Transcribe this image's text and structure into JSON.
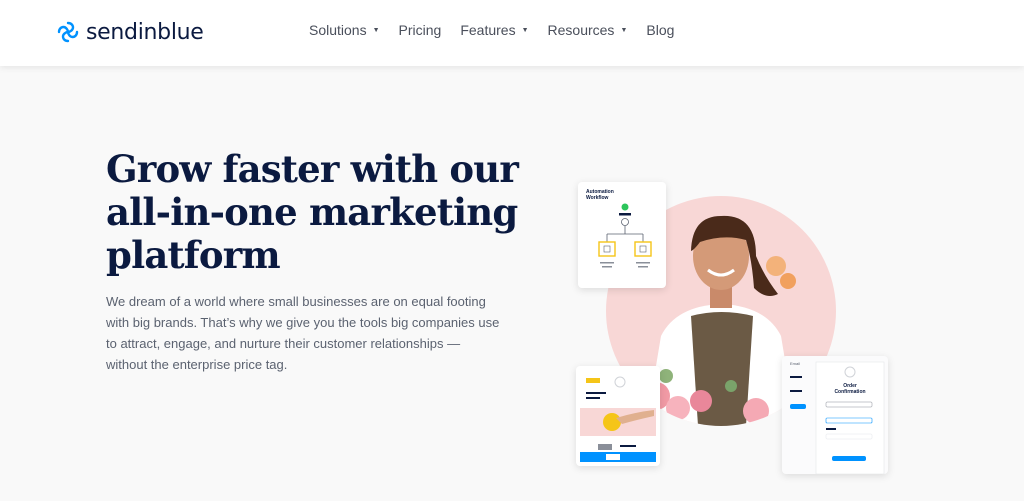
{
  "brand": {
    "name": "sendinblue",
    "color": "#0092ff"
  },
  "nav": [
    {
      "label": "Solutions",
      "caret": true
    },
    {
      "label": "Pricing",
      "caret": false
    },
    {
      "label": "Features",
      "caret": true
    },
    {
      "label": "Resources",
      "caret": true
    },
    {
      "label": "Blog",
      "caret": false
    }
  ],
  "hero": {
    "title_lines": [
      "Grow faster with our",
      "all-in-one marketing",
      "platform"
    ],
    "body_lines": [
      "We dream of a world where small businesses are on equal footing",
      "with big brands. That’s why we give you the tools big companies use",
      "to attract, engage, and nurture their customer relationships —",
      "without the enterprise price tag."
    ]
  },
  "illustration": {
    "workflow_card": {
      "title_1": "Automation",
      "title_2": "Workflow"
    },
    "order_card": {
      "title_1": "Order",
      "title_2": "Confirmation"
    },
    "email_panel": {
      "label": "Email"
    }
  },
  "colors": {
    "accent_blue": "#0092ff",
    "title_navy": "#0b1a40",
    "circle_pink": "#f8d7d6",
    "workflow_yellow": "#f5c518"
  }
}
